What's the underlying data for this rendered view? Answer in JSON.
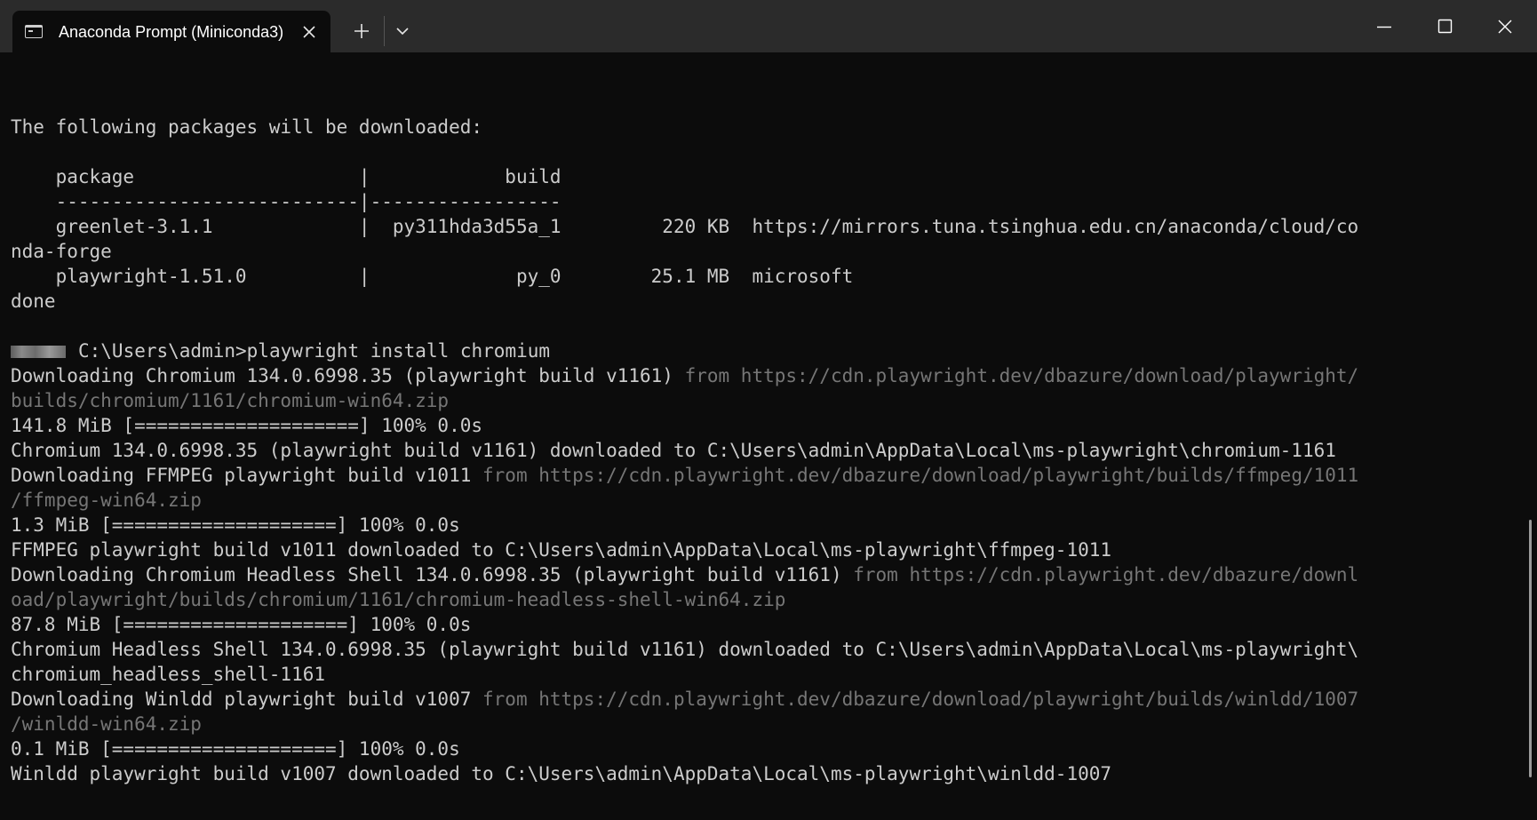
{
  "window": {
    "tab_title": "Anaconda Prompt (Miniconda3)",
    "icons": {
      "tab": "terminal-icon",
      "tab_close": "close-icon",
      "new_tab": "plus-icon",
      "dropdown": "chevron-down-icon",
      "minimize": "minimize-icon",
      "maximize": "maximize-icon",
      "close": "close-icon"
    }
  },
  "colors": {
    "background": "#0c0c0c",
    "titlebar": "#2b2b2b",
    "text": "#cccccc",
    "dim_text": "#767676"
  },
  "terminal": {
    "prompt_path": "C:\\Users\\admin>",
    "lines": [
      {
        "text": "The following packages will be downloaded:"
      },
      {
        "text": ""
      },
      {
        "text": "    package                    |            build"
      },
      {
        "text": "    ---------------------------|-----------------"
      },
      {
        "text": "    greenlet-3.1.1             |  py311hda3d55a_1         220 KB  https://mirrors.tuna.tsinghua.edu.cn/anaconda/cloud/co"
      },
      {
        "text": "nda-forge"
      },
      {
        "text": "    playwright-1.51.0          |             py_0        25.1 MB  microsoft"
      },
      {
        "text": "done"
      },
      {
        "text": ""
      },
      {
        "prompt": "C:\\Users\\admin>",
        "command": "playwright install chromium"
      },
      {
        "text": "Downloading Chromium 134.0.6998.35 (playwright build v1161) ",
        "dim": "from https://cdn.playwright.dev/dbazure/download/playwright/"
      },
      {
        "text": "",
        "dim": "builds/chromium/1161/chromium-win64.zip"
      },
      {
        "text": "141.8 MiB [====================] 100% 0.0s"
      },
      {
        "text": "Chromium 134.0.6998.35 (playwright build v1161) downloaded to C:\\Users\\admin\\AppData\\Local\\ms-playwright\\chromium-1161"
      },
      {
        "text": "Downloading FFMPEG playwright build v1011 ",
        "dim": "from https://cdn.playwright.dev/dbazure/download/playwright/builds/ffmpeg/1011"
      },
      {
        "text": "",
        "dim": "/ffmpeg-win64.zip"
      },
      {
        "text": "1.3 MiB [====================] 100% 0.0s"
      },
      {
        "text": "FFMPEG playwright build v1011 downloaded to C:\\Users\\admin\\AppData\\Local\\ms-playwright\\ffmpeg-1011"
      },
      {
        "text": "Downloading Chromium Headless Shell 134.0.6998.35 (playwright build v1161) ",
        "dim": "from https://cdn.playwright.dev/dbazure/downl"
      },
      {
        "text": "",
        "dim": "oad/playwright/builds/chromium/1161/chromium-headless-shell-win64.zip"
      },
      {
        "text": "87.8 MiB [====================] 100% 0.0s"
      },
      {
        "text": "Chromium Headless Shell 134.0.6998.35 (playwright build v1161) downloaded to C:\\Users\\admin\\AppData\\Local\\ms-playwright\\"
      },
      {
        "text": "chromium_headless_shell-1161"
      },
      {
        "text": "Downloading Winldd playwright build v1007 ",
        "dim": "from https://cdn.playwright.dev/dbazure/download/playwright/builds/winldd/1007"
      },
      {
        "text": "",
        "dim": "/winldd-win64.zip"
      },
      {
        "text": "0.1 MiB [====================] 100% 0.0s"
      },
      {
        "text": "Winldd playwright build v1007 downloaded to C:\\Users\\admin\\AppData\\Local\\ms-playwright\\winldd-1007"
      }
    ]
  }
}
